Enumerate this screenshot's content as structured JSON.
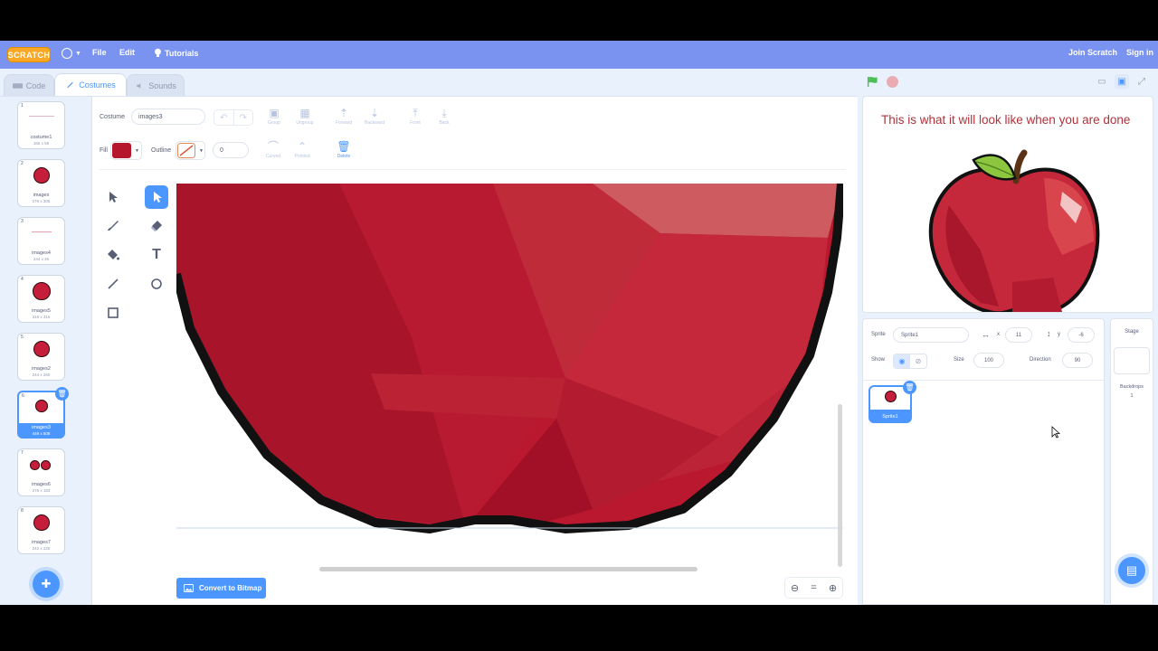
{
  "menubar": {
    "logo": "SCRATCH",
    "file": "File",
    "edit": "Edit",
    "tutorials": "Tutorials",
    "join": "Join Scratch",
    "signin": "Sign in"
  },
  "tabs": {
    "code": "Code",
    "costumes": "Costumes",
    "sounds": "Sounds"
  },
  "costumes": [
    {
      "num": "1",
      "name": "costume1",
      "size": "165 x 59"
    },
    {
      "num": "2",
      "name": "images",
      "size": "276 x 305"
    },
    {
      "num": "3",
      "name": "images4",
      "size": "244 x 26"
    },
    {
      "num": "4",
      "name": "images5",
      "size": "316 x 316"
    },
    {
      "num": "5",
      "name": "images2",
      "size": "244 x 260"
    },
    {
      "num": "6",
      "name": "images3",
      "size": "449 x 508"
    },
    {
      "num": "7",
      "name": "images6",
      "size": "275 x 183"
    },
    {
      "num": "8",
      "name": "images7",
      "size": "242 x 225"
    }
  ],
  "paint": {
    "costume_label": "Costume",
    "costume_name": "images3",
    "fill_label": "Fill",
    "outline_label": "Outline",
    "outline_width": "0",
    "fill_color": "#b5162d",
    "group": "Group",
    "ungroup": "Ungroup",
    "forward": "Forward",
    "backward": "Backward",
    "front": "Front",
    "back": "Back",
    "curved": "Curved",
    "pointed": "Pointed",
    "delete": "Delete",
    "convert": "Convert to Bitmap",
    "zoom_out": "⊖",
    "zoom_reset": "=",
    "zoom_in": "⊕"
  },
  "stage": {
    "text": "This is what it will look like when you are done"
  },
  "sprite_info": {
    "sprite_label": "Sprite",
    "sprite_name": "Sprite1",
    "x_label": "x",
    "x": "11",
    "y_label": "y",
    "y": "-6",
    "show_label": "Show",
    "size_label": "Size",
    "size": "100",
    "direction_label": "Direction",
    "direction": "90",
    "tile_name": "Sprite1"
  },
  "stage_pane": {
    "label": "Stage",
    "backdrops_label": "Backdrops",
    "backdrops_count": "1"
  },
  "colors": {
    "accent": "#4c97ff",
    "menubar": "#7b93f0",
    "apple": "#c41e3a"
  }
}
